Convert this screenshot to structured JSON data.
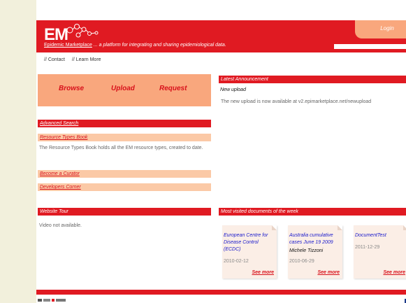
{
  "header": {
    "logo": "EM",
    "site_name": "Epidemic Marketplace",
    "tagline": "... a platform for integrating and sharing epidemiological data.",
    "login_label": "Login"
  },
  "nav": {
    "contact": "// Contact",
    "learn_more": "// Learn More"
  },
  "actions": {
    "browse": "Browse",
    "upload": "Upload",
    "request": "Request"
  },
  "left": {
    "advanced_search": "Advanced Search",
    "resource_types_book": "Resource Types Book",
    "resource_types_desc": "The Resource Types Book holds all the EM resource types, created to date.",
    "become_curator": "Become a Curator",
    "developers_corner": "Developers Corner",
    "website_tour": "Website Tour",
    "video_text": "Video not available."
  },
  "announcement": {
    "heading": "Latest Announcement",
    "title": "New upload",
    "text": "The new upload is now available at v2.epimarketplace.net/newupload"
  },
  "most_visited": {
    "heading": "Most visited documents of the week",
    "docs": [
      {
        "title": "European Centre for Disease Control (ECDC)",
        "author": "",
        "date": "2010-02-12",
        "more": "See more"
      },
      {
        "title": "Australia cumulative cases June 19 2009",
        "author": "Michele Tizzoni",
        "date": "2010-06-29",
        "more": "See more"
      },
      {
        "title": "DocumentTest",
        "author": "",
        "date": "2011-12-29",
        "more": "See more"
      }
    ]
  },
  "colors": {
    "brand_red": "#e01a22",
    "peach": "#f9a77d",
    "light_peach": "#fbc9a6",
    "page_bg": "#f2f0dc"
  }
}
